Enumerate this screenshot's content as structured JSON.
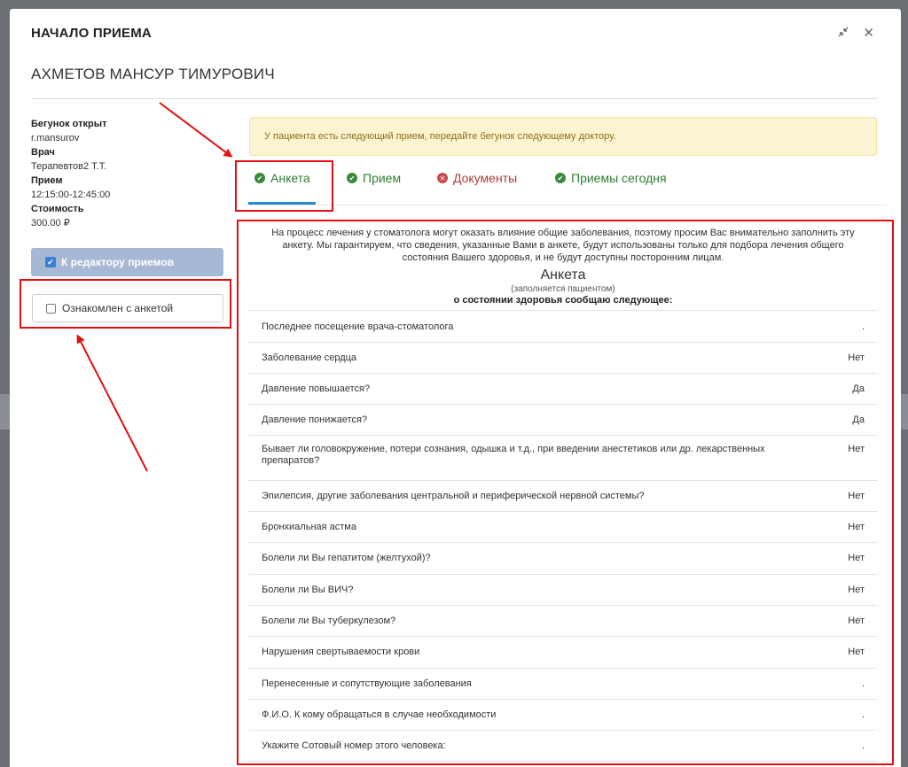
{
  "modal": {
    "title": "НАЧАЛО ПРИЕМА",
    "patient_name": "АХМЕТОВ МАНСУР ТИМУРОВИЧ",
    "minimize_icon": "compress-icon",
    "close_icon": "close-icon"
  },
  "info": {
    "runner_label": "Бегунок открыт",
    "runner_value": "r.mansurov",
    "doctor_label": "Врач",
    "doctor_value": "Терапевтов2 Т.Т.",
    "appointment_label": "Прием",
    "appointment_value": "12:15:00-12:45:00",
    "cost_label": "Стоимость",
    "cost_value": "300.00 ₽"
  },
  "buttons": {
    "editor_label": "К редактору приемов",
    "ack_label": "Ознакомлен с анкетой"
  },
  "alert": {
    "text": "У пациента есть следующий прием, передайте бегунок следующему доктору."
  },
  "tabs": [
    {
      "label": "Анкета",
      "status": "ok"
    },
    {
      "label": "Прием",
      "status": "ok"
    },
    {
      "label": "Документы",
      "status": "error"
    },
    {
      "label": "Приемы сегодня",
      "status": "ok"
    }
  ],
  "survey": {
    "intro": "На процесс лечения у стоматолога могут оказать влияние общие заболевания, поэтому просим Вас внимательно заполнить эту анкету. Мы гарантируем, что сведения, указанные Вами в анкете, будут использованы только для подбора лечения общего состояния Вашего здоровья, и не будут доступны посторонним лицам.",
    "title": "Анкета",
    "subtitle": "(заполняется пациентом)",
    "heading": "о состоянии здоровья сообщаю следующее:",
    "rows": [
      {
        "q": "Последнее посещение врача-стоматолога",
        "a": "."
      },
      {
        "q": "Заболевание сердца",
        "a": "Нет"
      },
      {
        "q": "Давление повышается?",
        "a": "Да"
      },
      {
        "q": "Давление понижается?",
        "a": "Да"
      },
      {
        "q": "Бывает ли головокружение, потери сознания, одышка и т.д., при введении анестетиков или др. лекарственных препаратов?",
        "a": "Нет"
      },
      {
        "q": "Эпилепсия, другие заболевания центральной и периферической нервной системы?",
        "a": "Нет"
      },
      {
        "q": "Бронхиальная астма",
        "a": "Нет"
      },
      {
        "q": "Болели ли Вы гепатитом (желтухой)?",
        "a": "Нет"
      },
      {
        "q": "Болели ли Вы ВИЧ?",
        "a": "Нет"
      },
      {
        "q": "Болели ли Вы туберкулезом?",
        "a": "Нет"
      },
      {
        "q": "Нарушения свертываемости крови",
        "a": "Нет"
      },
      {
        "q": "Перенесенные и сопутствующие заболевания",
        "a": "."
      },
      {
        "q": "Ф.И.О. К кому обращаться в случае необходимости",
        "a": "."
      },
      {
        "q": "Укажите Сотовый номер этого человека:",
        "a": "."
      }
    ]
  },
  "colors": {
    "accent": "#2a86d6",
    "annotation": "#e01010",
    "tab_ok": "#2f7d32",
    "tab_error": "#b23b3b",
    "alert_bg": "#fcf4d0"
  }
}
